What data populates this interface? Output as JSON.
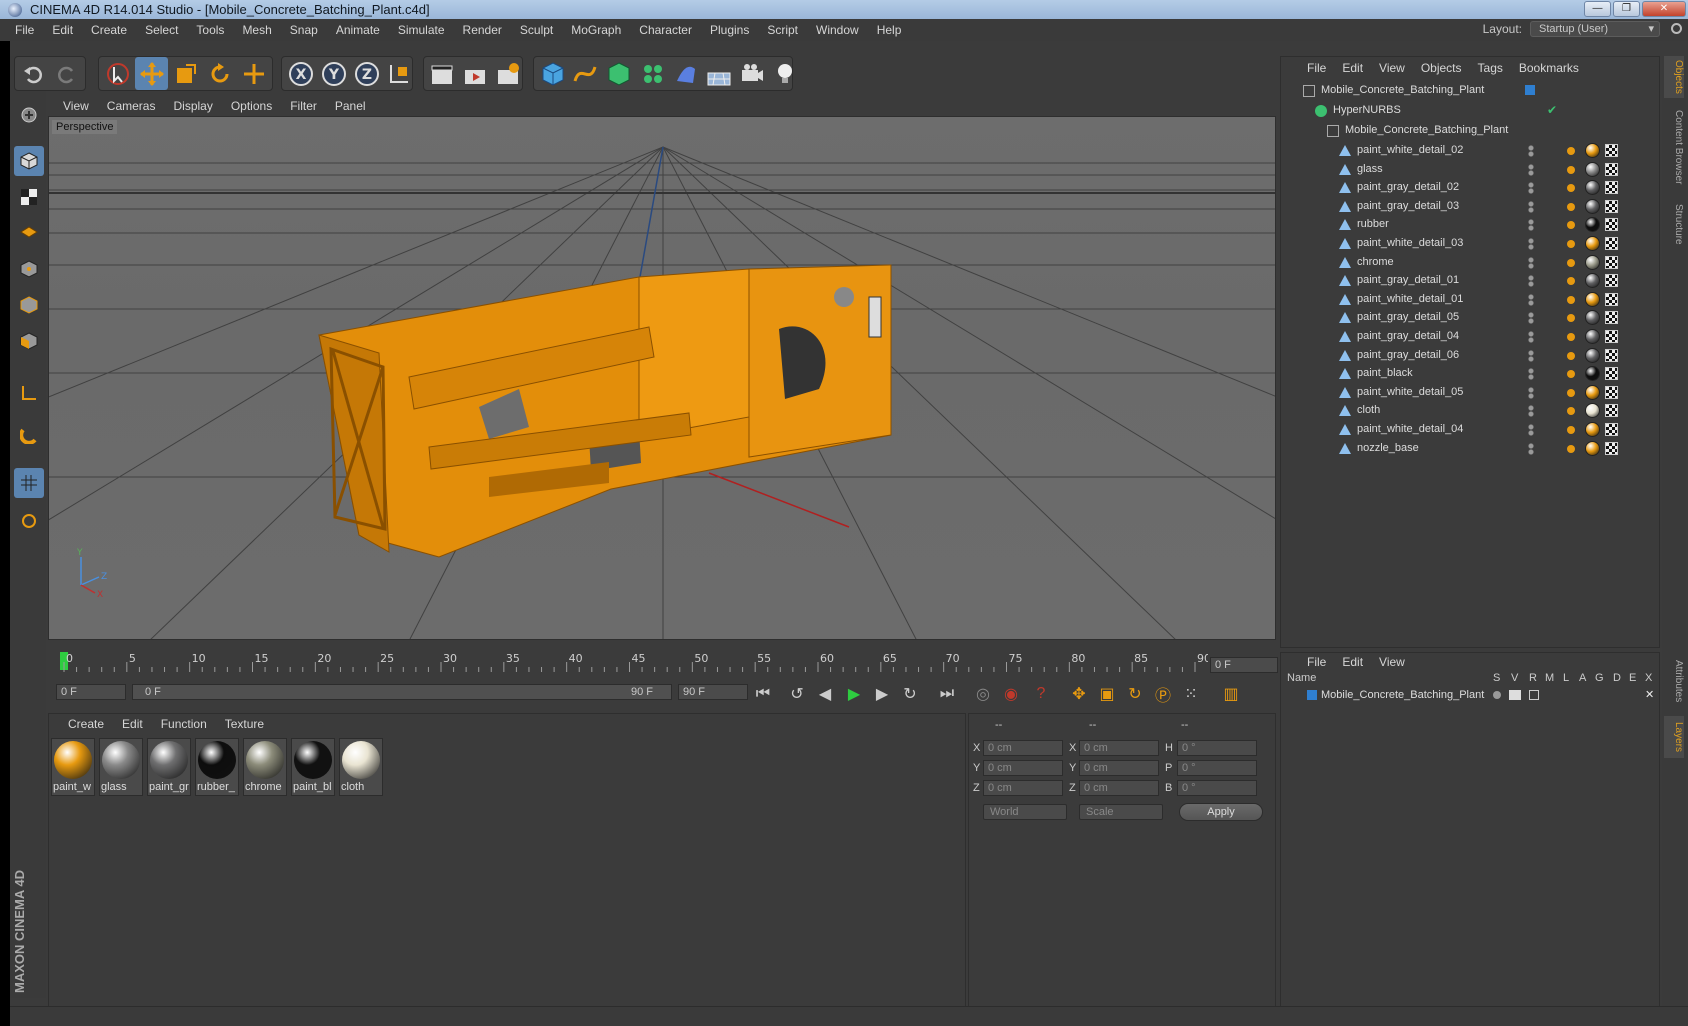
{
  "window": {
    "title": "CINEMA 4D R14.014 Studio - [Mobile_Concrete_Batching_Plant.c4d]"
  },
  "menubar": {
    "items": [
      "File",
      "Edit",
      "Create",
      "Select",
      "Tools",
      "Mesh",
      "Snap",
      "Animate",
      "Simulate",
      "Render",
      "Sculpt",
      "MoGraph",
      "Character",
      "Plugins",
      "Script",
      "Window",
      "Help"
    ],
    "layout_label": "Layout:",
    "layout_value": "Startup (User)"
  },
  "viewport": {
    "menu": [
      "View",
      "Cameras",
      "Display",
      "Options",
      "Filter",
      "Panel"
    ],
    "label": "Perspective"
  },
  "timeline": {
    "ticks": [
      "0",
      "5",
      "10",
      "15",
      "20",
      "25",
      "30",
      "35",
      "40",
      "45",
      "50",
      "55",
      "60",
      "65",
      "70",
      "75",
      "80",
      "85",
      "90"
    ],
    "current_frame": "0 F",
    "start_field": "0 F",
    "range_start": "0 F",
    "range_end": "90 F",
    "end_field": "90 F"
  },
  "materials": {
    "menu": [
      "Create",
      "Edit",
      "Function",
      "Texture"
    ],
    "items": [
      {
        "name": "paint_w",
        "color": "#e79a10"
      },
      {
        "name": "glass",
        "color": "#8a8a8a"
      },
      {
        "name": "paint_gr",
        "color": "#6f6f70"
      },
      {
        "name": "rubber_",
        "color": "#0d0d0d"
      },
      {
        "name": "chrome",
        "color": "#8c8c7a"
      },
      {
        "name": "paint_bl",
        "color": "#111111"
      },
      {
        "name": "cloth",
        "color": "#e9e4d2"
      }
    ]
  },
  "coordinates": {
    "headers": [
      "--",
      "--",
      "--"
    ],
    "rows": [
      {
        "a": "X",
        "av": "0 cm",
        "b": "X",
        "bv": "0 cm",
        "c": "H",
        "cv": "0 °"
      },
      {
        "a": "Y",
        "av": "0 cm",
        "b": "Y",
        "bv": "0 cm",
        "c": "P",
        "cv": "0 °"
      },
      {
        "a": "Z",
        "av": "0 cm",
        "b": "Z",
        "bv": "0 cm",
        "c": "B",
        "cv": "0 °"
      }
    ],
    "mode_select": "World",
    "scale_select": "Scale",
    "apply_label": "Apply"
  },
  "objects": {
    "menu": [
      "File",
      "Edit",
      "View",
      "Objects",
      "Tags",
      "Bookmarks"
    ],
    "root": "Mobile_Concrete_Batching_Plant",
    "hypernurbs": "HyperNURBS",
    "group": "Mobile_Concrete_Batching_Plant",
    "children": [
      {
        "name": "paint_white_detail_02",
        "mat": "#e79a10"
      },
      {
        "name": "glass",
        "mat": "#8a8a8a"
      },
      {
        "name": "paint_gray_detail_02",
        "mat": "#606062"
      },
      {
        "name": "paint_gray_detail_03",
        "mat": "#606062"
      },
      {
        "name": "rubber",
        "mat": "#0d0d0d"
      },
      {
        "name": "paint_white_detail_03",
        "mat": "#e79a10"
      },
      {
        "name": "chrome",
        "mat": "#9a9a8a"
      },
      {
        "name": "paint_gray_detail_01",
        "mat": "#606062"
      },
      {
        "name": "paint_white_detail_01",
        "mat": "#e79a10"
      },
      {
        "name": "paint_gray_detail_05",
        "mat": "#606062"
      },
      {
        "name": "paint_gray_detail_04",
        "mat": "#606062"
      },
      {
        "name": "paint_gray_detail_06",
        "mat": "#606062"
      },
      {
        "name": "paint_black",
        "mat": "#0d0d0d"
      },
      {
        "name": "paint_white_detail_05",
        "mat": "#e79a10"
      },
      {
        "name": "cloth",
        "mat": "#e9e4d2"
      },
      {
        "name": "paint_white_detail_04",
        "mat": "#e79a10"
      },
      {
        "name": "nozzle_base",
        "mat": "#e79a10"
      }
    ]
  },
  "layers": {
    "menu": [
      "File",
      "Edit",
      "View"
    ],
    "columns": [
      "Name",
      "S",
      "V",
      "R",
      "M",
      "L",
      "A",
      "G",
      "D",
      "E",
      "X"
    ],
    "row": "Mobile_Concrete_Batching_Plant"
  },
  "right_tabs": [
    "Objects",
    "Content Browser",
    "Structure",
    "Attributes",
    "Layers"
  ],
  "logo": "MAXON CINEMA 4D",
  "colors": {
    "accent": "#5b84b0",
    "model": "#e79a10",
    "background": "#3b3b3b"
  }
}
